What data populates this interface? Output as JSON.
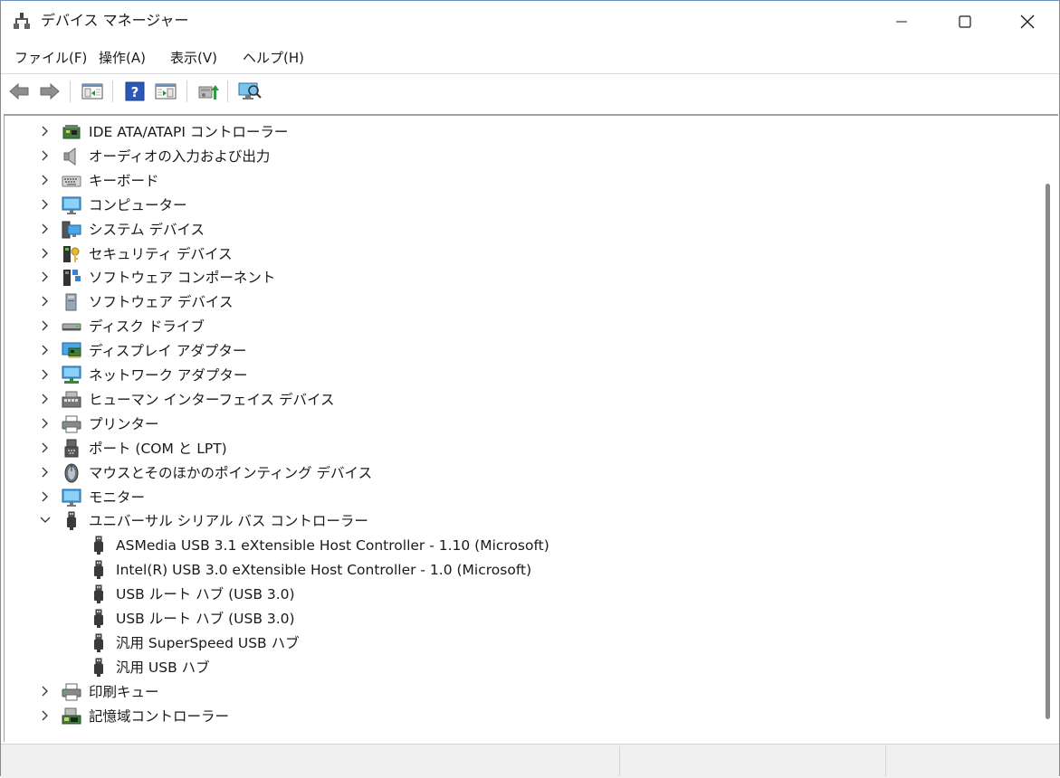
{
  "window": {
    "title": "デバイス マネージャー",
    "app_icon": "device-manager-icon"
  },
  "menu": [
    {
      "label": "ファイル(F)"
    },
    {
      "label": "操作(A)"
    },
    {
      "label": "表示(V)"
    },
    {
      "label": "ヘルプ(H)"
    }
  ],
  "toolbar": [
    {
      "icon": "back-arrow-icon"
    },
    {
      "icon": "forward-arrow-icon"
    },
    {
      "icon": "properties-pane-icon"
    },
    {
      "icon": "help-icon"
    },
    {
      "icon": "action-pane-icon"
    },
    {
      "icon": "update-driver-icon"
    },
    {
      "icon": "scan-hardware-icon"
    }
  ],
  "tree": [
    {
      "label": "IDE ATA/ATAPI コントローラー",
      "icon": "ide-controller-icon",
      "expanded": false
    },
    {
      "label": "オーディオの入力および出力",
      "icon": "speaker-icon",
      "expanded": false
    },
    {
      "label": "キーボード",
      "icon": "keyboard-icon",
      "expanded": false
    },
    {
      "label": "コンピューター",
      "icon": "monitor-icon",
      "expanded": false
    },
    {
      "label": "システム デバイス",
      "icon": "system-device-icon",
      "expanded": false
    },
    {
      "label": "セキュリティ デバイス",
      "icon": "security-key-icon",
      "expanded": false
    },
    {
      "label": "ソフトウェア コンポーネント",
      "icon": "software-component-icon",
      "expanded": false
    },
    {
      "label": "ソフトウェア デバイス",
      "icon": "software-device-icon",
      "expanded": false
    },
    {
      "label": "ディスク ドライブ",
      "icon": "disk-drive-icon",
      "expanded": false
    },
    {
      "label": "ディスプレイ アダプター",
      "icon": "display-adapter-icon",
      "expanded": false
    },
    {
      "label": "ネットワーク アダプター",
      "icon": "network-adapter-icon",
      "expanded": false
    },
    {
      "label": "ヒューマン インターフェイス デバイス",
      "icon": "hid-icon",
      "expanded": false
    },
    {
      "label": "プリンター",
      "icon": "printer-icon",
      "expanded": false
    },
    {
      "label": "ポート (COM と LPT)",
      "icon": "port-icon",
      "expanded": false
    },
    {
      "label": "マウスとそのほかのポインティング デバイス",
      "icon": "mouse-icon",
      "expanded": false
    },
    {
      "label": "モニター",
      "icon": "monitor-icon",
      "expanded": false
    },
    {
      "label": "ユニバーサル シリアル バス コントローラー",
      "icon": "usb-icon",
      "expanded": true
    },
    {
      "label": "ASMedia USB 3.1 eXtensible Host Controller - 1.10 (Microsoft)",
      "icon": "usb-icon",
      "child": true
    },
    {
      "label": "Intel(R) USB 3.0 eXtensible Host Controller - 1.0 (Microsoft)",
      "icon": "usb-icon",
      "child": true
    },
    {
      "label": "USB ルート ハブ (USB 3.0)",
      "icon": "usb-icon",
      "child": true
    },
    {
      "label": "USB ルート ハブ (USB 3.0)",
      "icon": "usb-icon",
      "child": true
    },
    {
      "label": "汎用 SuperSpeed USB ハブ",
      "icon": "usb-icon",
      "child": true
    },
    {
      "label": "汎用 USB ハブ",
      "icon": "usb-icon",
      "child": true
    },
    {
      "label": "印刷キュー",
      "icon": "printer-icon",
      "expanded": false
    },
    {
      "label": "記憶域コントローラー",
      "icon": "storage-controller-icon",
      "expanded": false
    }
  ]
}
